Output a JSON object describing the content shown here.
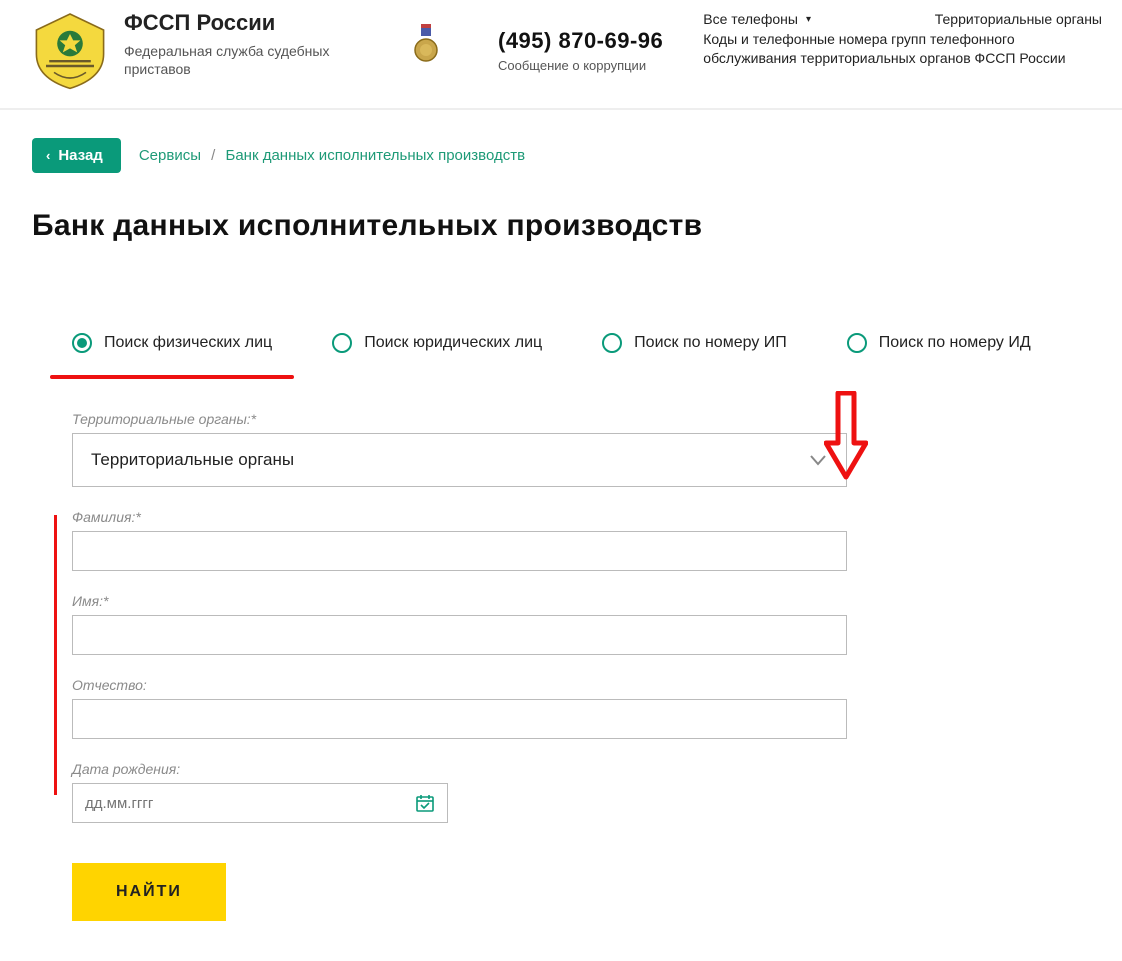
{
  "header": {
    "org_title": "ФССП России",
    "org_subtitle": "Федеральная служба судебных приставов",
    "phone_number": "(495) 870-69-96",
    "phone_caption": "Сообщение о коррупции",
    "all_phones": "Все телефоны",
    "link_territorial": "Территориальные органы",
    "link_codes": "Коды и телефонные номера групп телефонного обслуживания территориальных органов ФССП России"
  },
  "nav": {
    "back_label": "Назад",
    "crumb_services": "Сервисы",
    "crumb_current": "Банк данных исполнительных производств"
  },
  "page": {
    "title": "Банк данных исполнительных производств"
  },
  "tabs": {
    "t1": "Поиск физических лиц",
    "t2": "Поиск юридических лиц",
    "t3": "Поиск по номеру ИП",
    "t4": "Поиск по номеру ИД"
  },
  "form": {
    "territorial_label": "Территориальные органы:*",
    "territorial_value": "Территориальные органы",
    "lastname_label": "Фамилия:*",
    "firstname_label": "Имя:*",
    "patronymic_label": "Отчество:",
    "dob_label": "Дата рождения:",
    "dob_placeholder": "дд.мм.гггг",
    "find_label": "НАЙТИ"
  }
}
